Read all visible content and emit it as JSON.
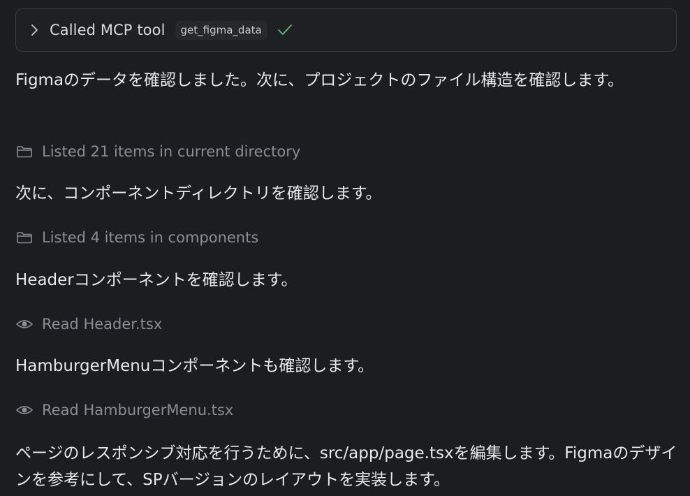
{
  "tool_call": {
    "label": "Called MCP tool",
    "tool_name": "get_figma_data",
    "status_icon": "check-icon",
    "status_color": "#5fb97c"
  },
  "messages": [
    {
      "text": "Figmaのデータを確認しました。次に、プロジェクトのファイル構造を確認します。"
    },
    {
      "text": "次に、コンポーネントディレクトリを確認します。"
    },
    {
      "text": "Headerコンポーネントを確認します。"
    },
    {
      "text": "HamburgerMenuコンポーネントも確認します。"
    },
    {
      "text": "ページのレスポンシブ対応を行うために、src/app/page.tsxを編集します。Figmaのデザインを参考にして、SPバージョンのレイアウトを実装します。"
    }
  ],
  "activities": [
    {
      "icon": "folder-icon",
      "text": "Listed 21 items in current directory"
    },
    {
      "icon": "folder-icon",
      "text": "Listed 4 items in components"
    },
    {
      "icon": "eye-icon",
      "text": "Read Header.tsx"
    },
    {
      "icon": "eye-icon",
      "text": "Read HamburgerMenu.tsx"
    }
  ],
  "colors": {
    "background": "#1b1d20",
    "text": "#e7e8ea",
    "muted": "#8a8d93",
    "card_border": "#3a3d42"
  }
}
